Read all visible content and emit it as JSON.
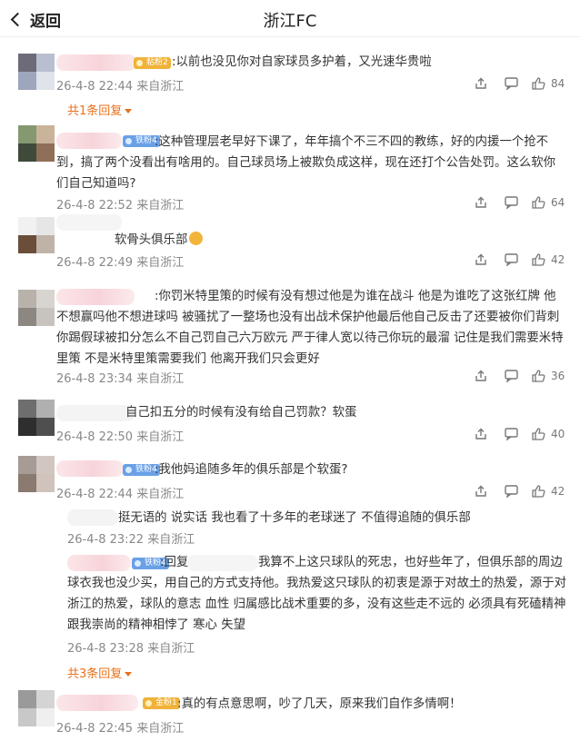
{
  "header": {
    "back_label": "返回",
    "title": "浙江FC"
  },
  "comments": [
    {
      "badge": "粘粉2",
      "text": ":以前也没见你对自家球员多护着，又光速华贵啦",
      "meta": "26-4-8 22:44 来自浙江",
      "likes": "84",
      "replies": "共1条回复"
    },
    {
      "badge": "铁粉4",
      "text": ":这种管理层老早好下课了，年年搞个不三不四的教练，好的内援一个抢不到，搞了两个没看出有啥用的。自己球员场上被欺负成这样，现在还打个公告处罚。这么软你们自己知道吗?",
      "meta": "26-4-8 22:52 来自浙江",
      "likes": "64"
    },
    {
      "text": "软骨头俱乐部",
      "meta": "26-4-8 22:49 来自浙江",
      "likes": "42"
    },
    {
      "text": ":你罚米特里策的时候有没有想过他是为谁在战斗 他是为谁吃了这张红牌 他不想赢吗他不想进球吗 被骚扰了一整场也没有出战术保护他最后他自己反击了还要被你们背刺 你踢假球被扣分怎么不自己罚自己六万欧元 严于律人宽以待己你玩的最溜 记住是我们需要米特里策 不是米特里策需要我们 他离开我们只会更好",
      "meta": "26-4-8 23:34 来自浙江",
      "likes": "36"
    },
    {
      "text": "自己扣五分的时候有没有给自己罚款？软蛋",
      "meta": "26-4-8 22:50 来自浙江",
      "likes": "40"
    },
    {
      "badge": "铁粉4",
      "text": ":我他妈追随多年的俱乐部是个软蛋?",
      "meta": "26-4-8 22:44 来自浙江",
      "likes": "42"
    },
    {
      "badge": "金粉1",
      "text": ":真的有点意思啊，吵了几天，原来我们自作多情啊！",
      "meta": "26-4-8 22:45 来自浙江"
    }
  ],
  "sub_replies": [
    {
      "text": "挺无语的 说实话 我也看了十多年的老球迷了 不值得追随的俱乐部",
      "meta": "26-4-8 23:22 来自浙江"
    },
    {
      "badge": "铁粉4",
      "prefix": ":回复",
      "text": "我算不上这只球队的死忠，也好些年了，但俱乐部的周边球衣我也没少买，用自己的方式支持他。我热爱这只球队的初衷是源于对故土的热爱，源于对浙江的热爱，球队的意志 血性 归属感比战术重要的多，没有这些走不远的 必须具有死磕精神跟我崇尚的精神相悖了 寒心 失望",
      "meta": "26-4-8 23:28 来自浙江",
      "replies": "共3条回复"
    }
  ],
  "colors": {
    "accent": "#e8711a",
    "meta": "#888888",
    "badge_blue": "#6aa0e6",
    "badge_gold": "#f0b23a"
  },
  "icons": {
    "share": "share-icon",
    "comment": "comment-icon",
    "like": "thumbs-up-icon"
  }
}
